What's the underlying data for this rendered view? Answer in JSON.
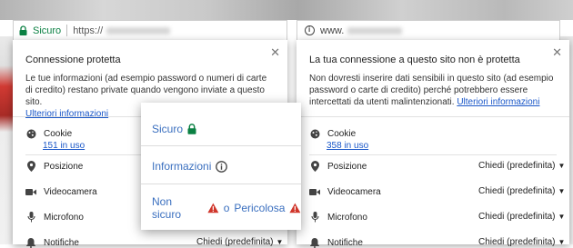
{
  "left": {
    "url": {
      "secure_label": "Sicuro",
      "scheme": "https://"
    },
    "title": "Connessione protetta",
    "description": "Le tue informazioni (ad esempio password o numeri di carte di credito) restano private quando vengono inviate a questo sito.",
    "learn_more": "Ulteriori informazioni",
    "cookie": {
      "label": "Cookie",
      "count_link": "151 in uso"
    },
    "permissions": [
      {
        "label": "Posizione"
      },
      {
        "label": "Videocamera"
      },
      {
        "label": "Microfono"
      },
      {
        "label": "Notifiche",
        "value": "Chiedi (predefinita)"
      }
    ]
  },
  "right": {
    "url": {
      "host": "www."
    },
    "title": "La tua connessione a questo sito non è protetta",
    "description": "Non dovresti inserire dati sensibili in questo sito (ad esempio password o carte di credito) perché potrebbero essere intercettati da utenti malintenzionati.",
    "learn_more": "Ulteriori informazioni",
    "cookie": {
      "label": "Cookie",
      "count_link": "358 in uso"
    },
    "permissions": [
      {
        "label": "Posizione",
        "value": "Chiedi (predefinita)"
      },
      {
        "label": "Videocamera",
        "value": "Chiedi (predefinita)"
      },
      {
        "label": "Microfono",
        "value": "Chiedi (predefinita)"
      },
      {
        "label": "Notifiche",
        "value": "Chiedi (predefinita)"
      }
    ]
  },
  "overlay": {
    "secure": "Sicuro",
    "info": "Informazioni",
    "unsafe": "Non sicuro",
    "or": "o",
    "dangerous": "Pericolosa"
  },
  "colors": {
    "secure_green": "#0b8043",
    "link_blue": "#1a57c8",
    "warning_red": "#d0352a",
    "overlay_text": "#3a6fbf"
  },
  "icons": [
    "lock-icon",
    "info-icon",
    "close-icon",
    "cookie-icon",
    "location-pin-icon",
    "videocam-icon",
    "microphone-icon",
    "notification-bell-icon",
    "warning-triangle-icon",
    "dropdown-arrow-icon"
  ]
}
